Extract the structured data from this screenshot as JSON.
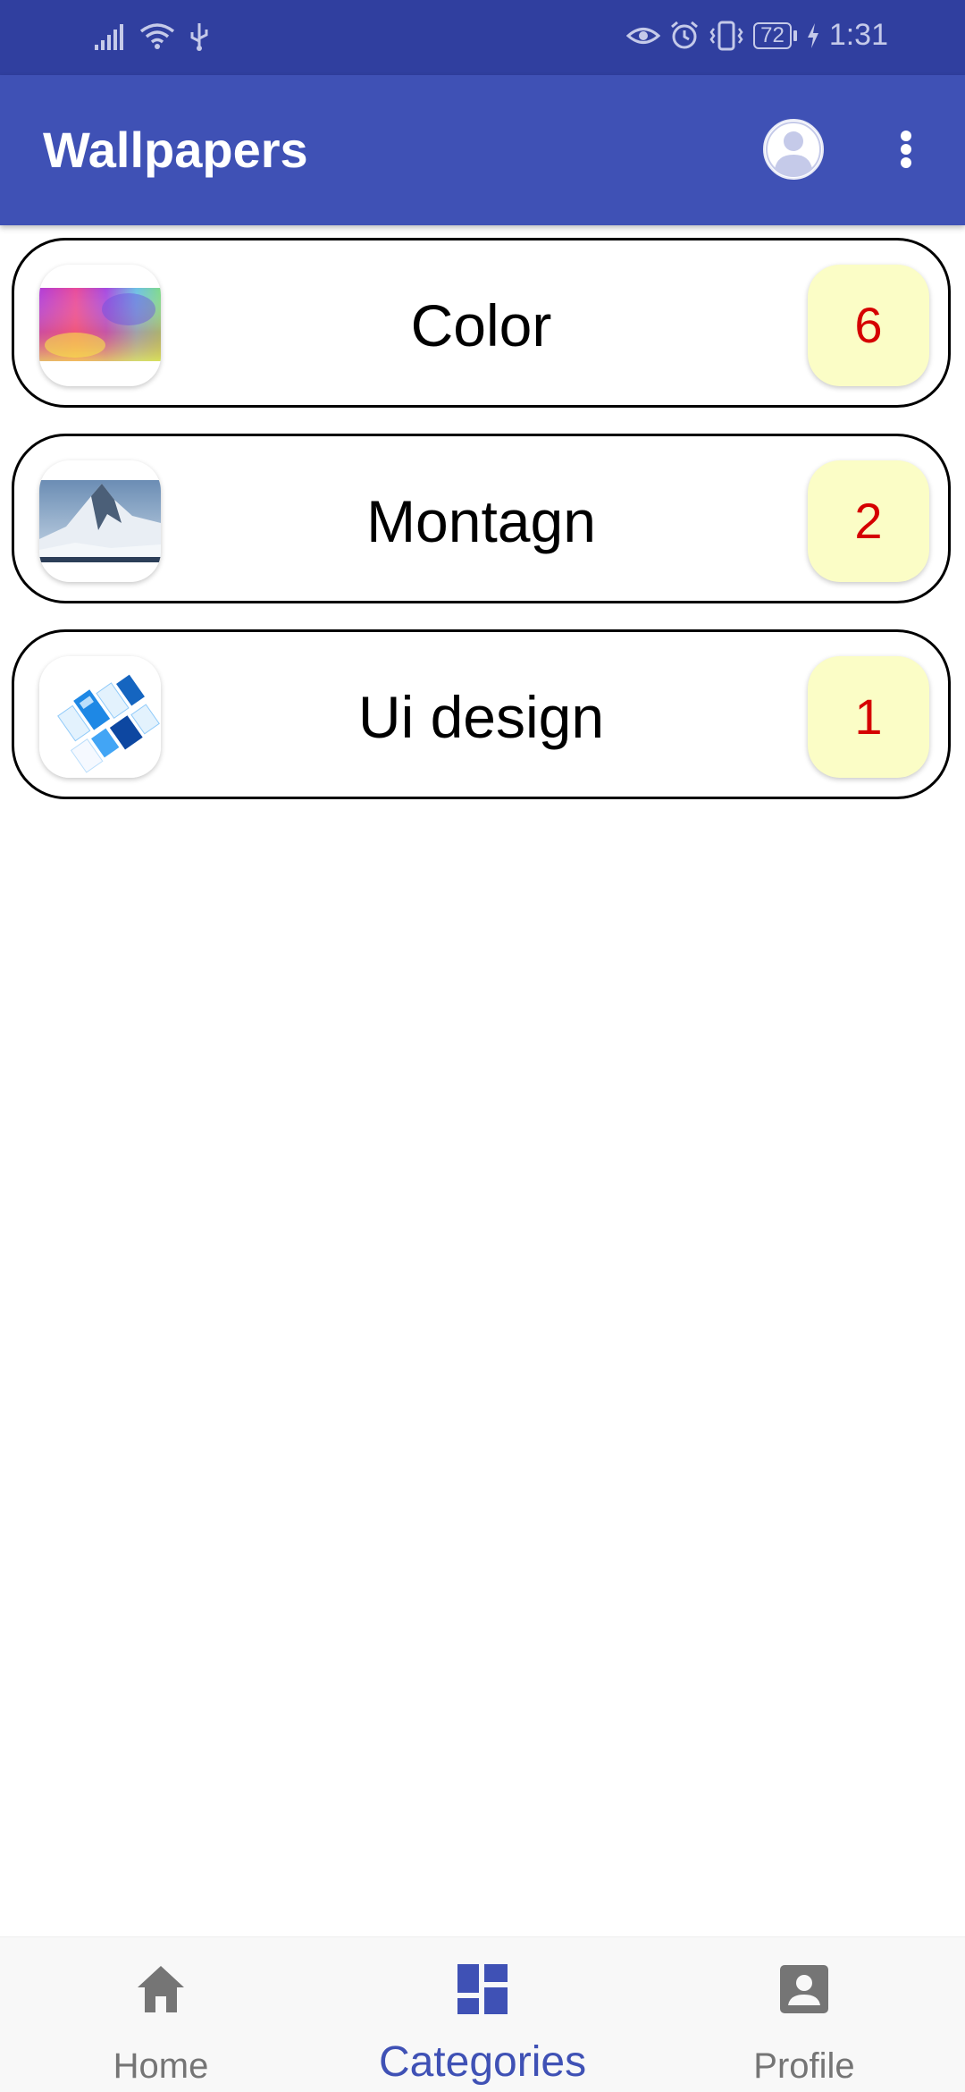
{
  "status_bar": {
    "battery_level": "72",
    "time": "1:31",
    "icons": [
      "signal-icon",
      "wifi-icon",
      "usb-icon",
      "eye-comfort-icon",
      "alarm-icon",
      "vibrate-icon",
      "battery-icon",
      "charging-icon"
    ]
  },
  "app_bar": {
    "title": "Wallpapers",
    "icons": [
      "account-circle-icon",
      "more-vert-icon"
    ]
  },
  "categories": [
    {
      "name": "Color",
      "count": "6",
      "thumbnail": "color-gradient-thumbnail"
    },
    {
      "name": "Montagn",
      "count": "2",
      "thumbnail": "mountain-thumbnail"
    },
    {
      "name": "Ui design",
      "count": "1",
      "thumbnail": "ui-design-thumbnail"
    }
  ],
  "bottom_nav": {
    "items": [
      {
        "label": "Home",
        "icon": "home-icon",
        "active": false
      },
      {
        "label": "Categories",
        "icon": "dashboard-icon",
        "active": true
      },
      {
        "label": "Profile",
        "icon": "account-box-icon",
        "active": false
      }
    ]
  },
  "colors": {
    "status_bar": "#303f9f",
    "primary": "#3f51b5",
    "badge_background": "#fbfdc6",
    "badge_text": "#d50000",
    "nav_inactive": "#757575",
    "nav_active": "#3f51b5"
  }
}
